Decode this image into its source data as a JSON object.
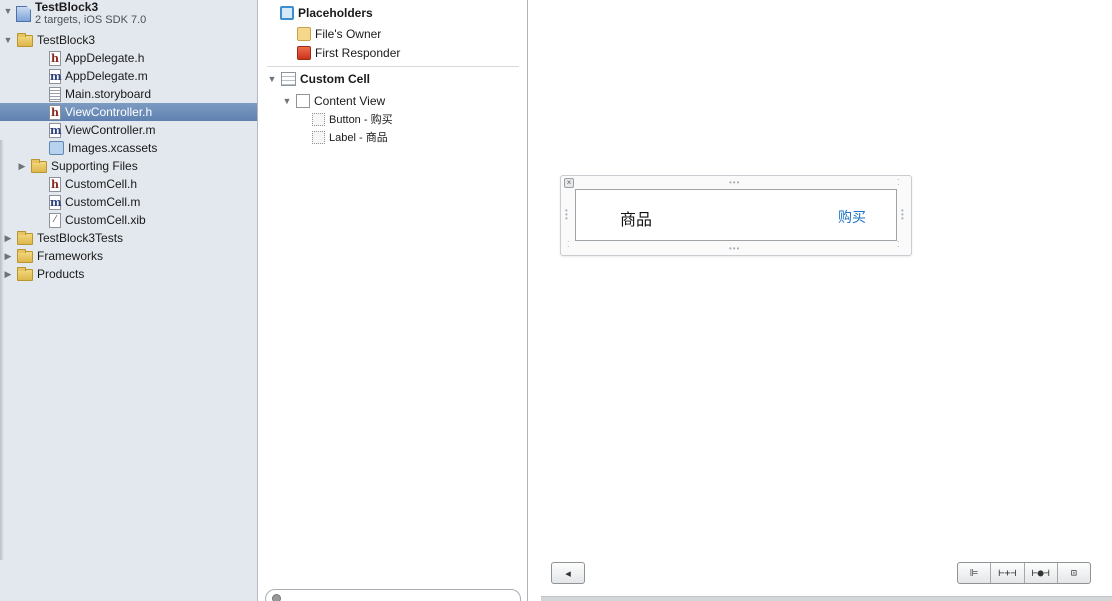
{
  "navigator": {
    "project": {
      "name": "TestBlock3",
      "subtitle": "2 targets, iOS SDK 7.0"
    },
    "items": [
      {
        "label": "TestBlock3",
        "kind": "folder",
        "icon": "folder-icon",
        "expanded": true
      },
      {
        "label": "AppDelegate.h",
        "kind": "header",
        "icon": "header-file-icon",
        "glyph": "h"
      },
      {
        "label": "AppDelegate.m",
        "kind": "impl",
        "icon": "implementation-file-icon",
        "glyph": "m"
      },
      {
        "label": "Main.storyboard",
        "kind": "storyboard",
        "icon": "storyboard-file-icon",
        "glyph": ""
      },
      {
        "label": "ViewController.h",
        "kind": "header",
        "icon": "header-file-icon",
        "glyph": "h",
        "selected": true
      },
      {
        "label": "ViewController.m",
        "kind": "impl",
        "icon": "implementation-file-icon",
        "glyph": "m"
      },
      {
        "label": "Images.xcassets",
        "kind": "assets",
        "icon": "asset-catalog-icon",
        "glyph": ""
      },
      {
        "label": "Supporting Files",
        "kind": "folder",
        "icon": "folder-icon",
        "expanded": false
      },
      {
        "label": "CustomCell.h",
        "kind": "header",
        "icon": "header-file-icon",
        "glyph": "h"
      },
      {
        "label": "CustomCell.m",
        "kind": "impl",
        "icon": "implementation-file-icon",
        "glyph": "m"
      },
      {
        "label": "CustomCell.xib",
        "kind": "xib",
        "icon": "xib-file-icon",
        "glyph": "⁄"
      },
      {
        "label": "TestBlock3Tests",
        "kind": "folder",
        "icon": "folder-icon",
        "expanded": false
      },
      {
        "label": "Frameworks",
        "kind": "folder",
        "icon": "folder-icon",
        "expanded": false
      },
      {
        "label": "Products",
        "kind": "folder",
        "icon": "folder-icon",
        "expanded": false
      }
    ]
  },
  "outline": {
    "placeholders": "Placeholders",
    "files_owner": "File's Owner",
    "first_responder": "First Responder",
    "custom_cell": "Custom Cell",
    "content_view": "Content View",
    "button_item": "Button - 购买",
    "label_item": "Label - 商品"
  },
  "canvas": {
    "cell_label": "商品",
    "cell_button": "购买",
    "close_glyph": "×",
    "back_glyph": "◂",
    "accent_color": "#1e73c9",
    "layout_buttons": [
      "align-icon",
      "pin-icon",
      "resolve-icon",
      "resize-icon"
    ],
    "layout_glyphs": [
      "⊫",
      "⊢+⊣",
      "⊢●⊣",
      "⊡"
    ]
  },
  "colors": {
    "navigator_bg": "#e3e8ee",
    "selection": "#6a8bb9"
  }
}
